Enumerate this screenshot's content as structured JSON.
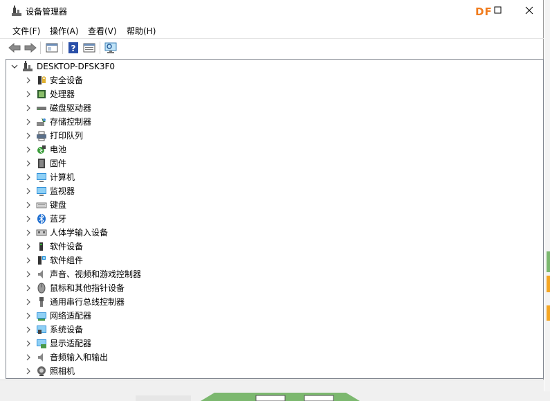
{
  "window": {
    "title": "设备管理器",
    "brand": "DF",
    "controls": {
      "maximize": "maximize",
      "close": "close"
    }
  },
  "menu": [
    "文件(F)",
    "操作(A)",
    "查看(V)",
    "帮助(H)"
  ],
  "toolbar": {
    "buttons": [
      "back-icon",
      "forward-icon",
      "show-hide-tree-icon",
      "help-icon",
      "properties-icon",
      "scan-hardware-icon"
    ]
  },
  "tree": {
    "root": "DESKTOP-DFSK3F0",
    "categories": [
      {
        "label": "安全设备",
        "icon": "security-device-icon"
      },
      {
        "label": "处理器",
        "icon": "processor-icon"
      },
      {
        "label": "磁盘驱动器",
        "icon": "disk-drive-icon"
      },
      {
        "label": "存储控制器",
        "icon": "storage-controller-icon"
      },
      {
        "label": "打印队列",
        "icon": "print-queue-icon"
      },
      {
        "label": "电池",
        "icon": "battery-icon"
      },
      {
        "label": "固件",
        "icon": "firmware-icon"
      },
      {
        "label": "计算机",
        "icon": "computer-icon"
      },
      {
        "label": "监视器",
        "icon": "monitor-icon"
      },
      {
        "label": "键盘",
        "icon": "keyboard-icon"
      },
      {
        "label": "蓝牙",
        "icon": "bluetooth-icon"
      },
      {
        "label": "人体学输入设备",
        "icon": "hid-icon"
      },
      {
        "label": "软件设备",
        "icon": "software-device-icon"
      },
      {
        "label": "软件组件",
        "icon": "software-component-icon"
      },
      {
        "label": "声音、视频和游戏控制器",
        "icon": "sound-icon"
      },
      {
        "label": "鼠标和其他指针设备",
        "icon": "mouse-icon"
      },
      {
        "label": "通用串行总线控制器",
        "icon": "usb-icon"
      },
      {
        "label": "网络适配器",
        "icon": "network-adapter-icon"
      },
      {
        "label": "系统设备",
        "icon": "system-device-icon"
      },
      {
        "label": "显示适配器",
        "icon": "display-adapter-icon"
      },
      {
        "label": "音频输入和输出",
        "icon": "audio-io-icon"
      },
      {
        "label": "照相机",
        "icon": "camera-icon"
      }
    ]
  },
  "colors": {
    "brand": "#f07c1e",
    "background_strips": [
      "#2e7d32",
      "#f5a623",
      "#f5a623"
    ]
  }
}
